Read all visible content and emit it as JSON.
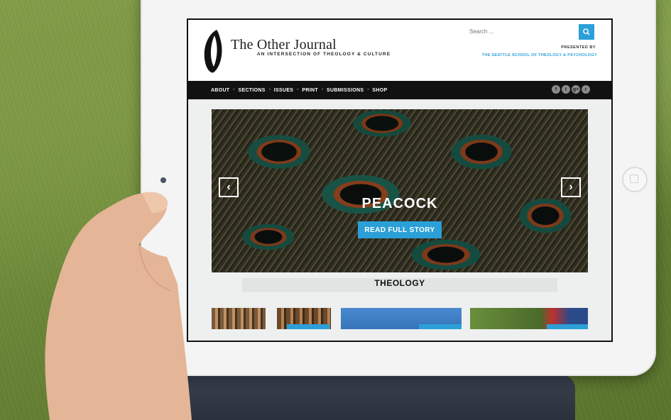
{
  "site": {
    "title": "The Other Journal",
    "subtitle": "AN INTERSECTION OF THEOLOGY & CULTURE",
    "presented_by": "PRESENTED BY",
    "presenter": "THE SEATTLE SCHOOL OF THEOLOGY & PSYCHOLOGY"
  },
  "search": {
    "placeholder": "Search ..."
  },
  "nav": {
    "items": [
      {
        "label": "ABOUT"
      },
      {
        "label": "SECTIONS"
      },
      {
        "label": "ISSUES"
      },
      {
        "label": "PRINT"
      },
      {
        "label": "SUBMISSIONS"
      },
      {
        "label": "SHOP"
      }
    ],
    "separator": "•"
  },
  "socials": [
    {
      "icon": "facebook-icon",
      "glyph": "f"
    },
    {
      "icon": "twitter-icon",
      "glyph": "t"
    },
    {
      "icon": "google-plus-icon",
      "glyph": "g+"
    },
    {
      "icon": "rss-icon",
      "glyph": "r"
    }
  ],
  "hero": {
    "title": "PEACOCK",
    "button": "READ FULL STORY"
  },
  "section": {
    "title": "THEOLOGY"
  },
  "colors": {
    "accent": "#2ba0d8",
    "nav_bg": "#111111"
  }
}
